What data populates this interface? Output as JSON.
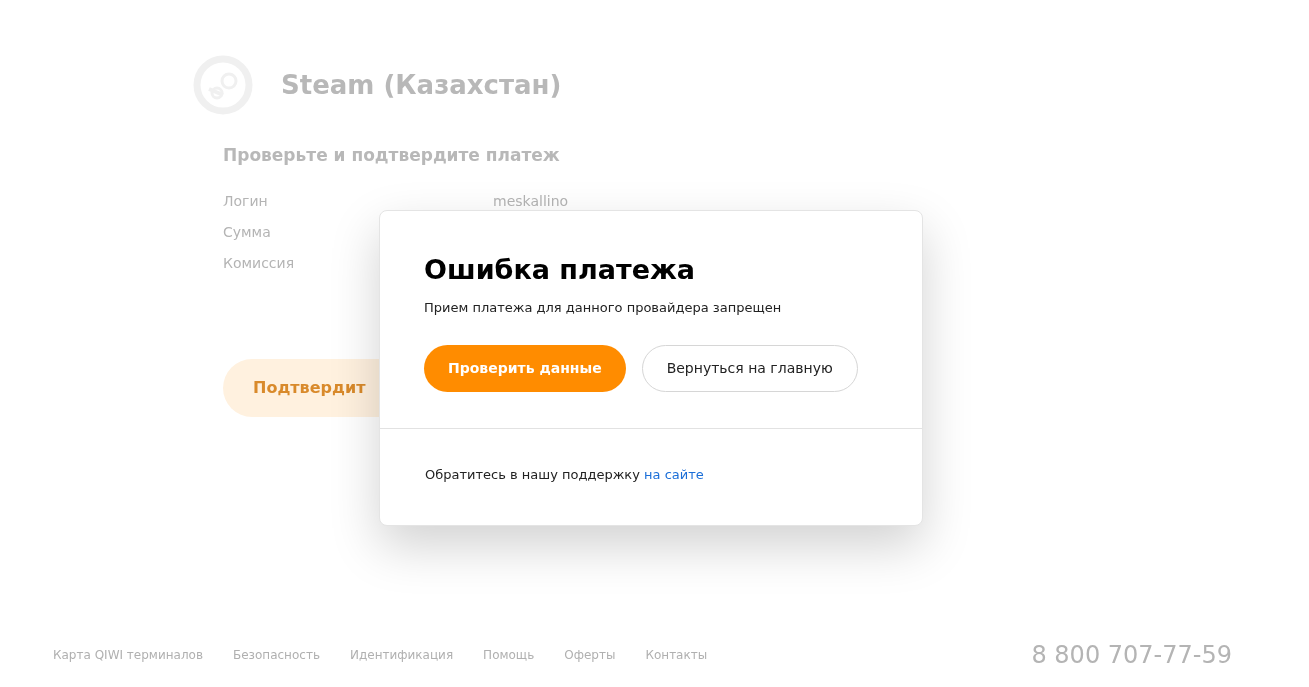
{
  "provider": {
    "title": "Steam (Казахстан)"
  },
  "payment": {
    "heading": "Проверьте и подтвердите платеж",
    "fields": [
      {
        "label": "Логин",
        "value": "meskallino"
      },
      {
        "label": "Сумма"
      },
      {
        "label": "Комиссия"
      }
    ],
    "confirm_button": "Подтвердит"
  },
  "footer": {
    "links": [
      "Карта QIWI терминалов",
      "Безопасность",
      "Идентификация",
      "Помощь",
      "Оферты",
      "Контакты"
    ],
    "phone": "8 800 707-77-59"
  },
  "modal": {
    "title": "Ошибка платежа",
    "message": "Прием платежа для данного провайдера запрещен",
    "buttons": [
      {
        "label": "Проверить данные",
        "kind": "primary"
      },
      {
        "label": "Вернуться на главную",
        "kind": "secondary"
      }
    ],
    "support_text": "Обратитесь в нашу поддержку",
    "support_link": "на сайте"
  }
}
